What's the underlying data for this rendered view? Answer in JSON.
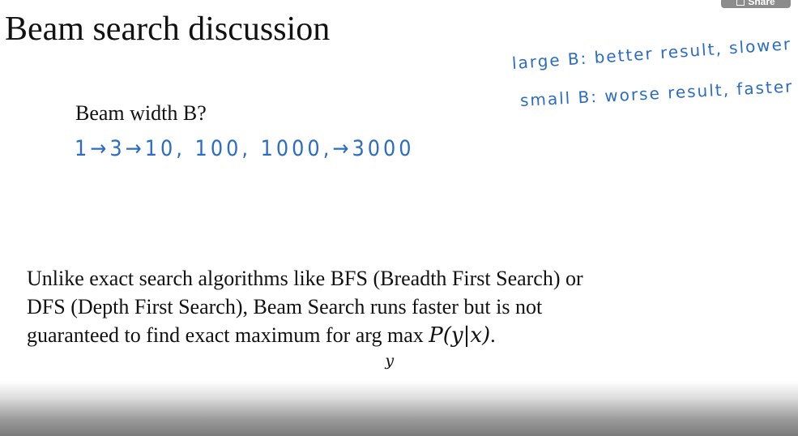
{
  "slide": {
    "title": "Beam search discussion",
    "question": "Beam width B?",
    "body_lines": [
      "Unlike exact search algorithms like BFS (Breadth First Search) or",
      "DFS (Depth First Search), Beam Search runs faster but is not",
      "guaranteed to find exact maximum for"
    ],
    "argmax_label": "arg max",
    "argmax_subscript": "y",
    "argmax_expression": "P(y|x)",
    "body_end": "."
  },
  "annotations": {
    "beam_width_sequence": "1→3→10,   100,   1000,→3000",
    "large_b": "large B: better result, slower",
    "small_b": "small B: worse result, faster"
  },
  "player": {
    "share_label": "Share"
  },
  "colors": {
    "handwriting": "#2b6cc4",
    "text": "#111111",
    "background": "#ffffff",
    "share_button": "#8c8c8c"
  }
}
